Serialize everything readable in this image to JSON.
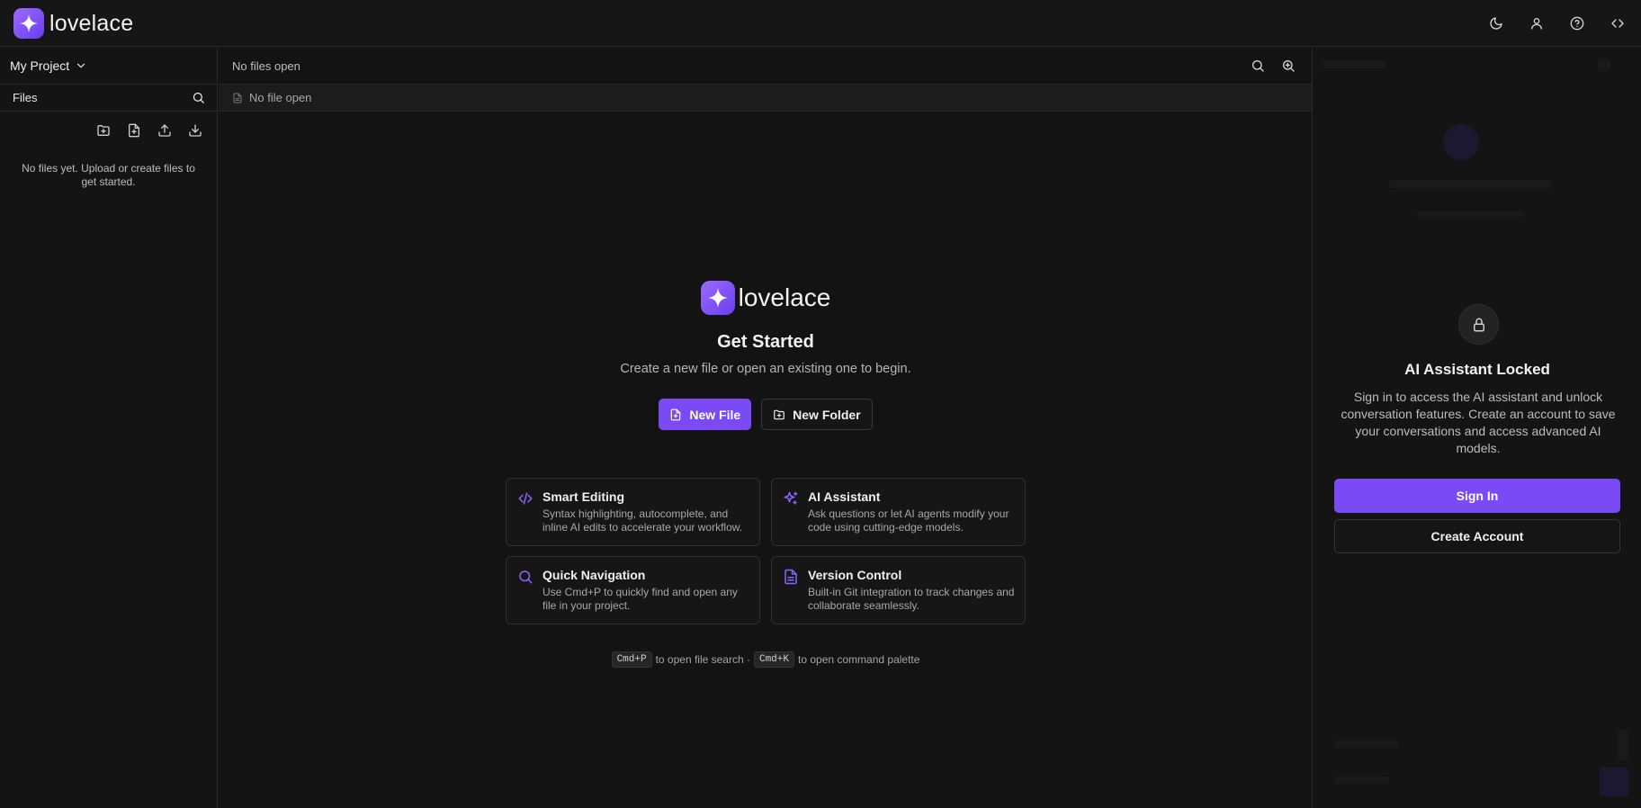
{
  "app": {
    "logo_text": "lovelace",
    "accent_color": "#7a4af5",
    "top_icons": [
      "moon-icon",
      "user-icon",
      "help-icon",
      "code-icon"
    ]
  },
  "sidebar": {
    "project_name": "My Project",
    "files_label": "Files",
    "file_actions": [
      "new-folder-icon",
      "new-file-icon",
      "upload-icon",
      "download-icon"
    ],
    "empty_message": "No files yet. Upload or create files to get started."
  },
  "editor": {
    "header_text": "No files open",
    "tab_text": "No file open"
  },
  "welcome": {
    "logo_text": "lovelace",
    "title": "Get Started",
    "subtitle": "Create a new file or open an existing one to begin.",
    "new_file_label": "New File",
    "new_folder_label": "New Folder",
    "features": [
      {
        "icon": "code-icon",
        "title": "Smart Editing",
        "desc": "Syntax highlighting, autocomplete, and inline AI edits to accelerate your workflow."
      },
      {
        "icon": "sparkles-icon",
        "title": "AI Assistant",
        "desc": "Ask questions or let AI agents modify your code using cutting-edge models."
      },
      {
        "icon": "search-icon",
        "title": "Quick Navigation",
        "desc": "Use Cmd+P to quickly find and open any file in your project."
      },
      {
        "icon": "document-icon",
        "title": "Version Control",
        "desc": "Built-in Git integration to track changes and collaborate seamlessly."
      }
    ],
    "shortcut_1_key": "Cmd+P",
    "shortcut_1_text": "to open file search ·",
    "shortcut_2_key": "Cmd+K",
    "shortcut_2_text": "to open command palette"
  },
  "ai_panel": {
    "title": "AI Assistant Locked",
    "description": "Sign in to access the AI assistant and unlock conversation features. Create an account to save your conversations and access advanced AI models.",
    "sign_in_label": "Sign In",
    "create_account_label": "Create Account"
  }
}
